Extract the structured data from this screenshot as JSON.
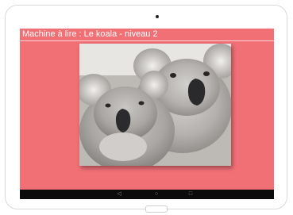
{
  "app": {
    "title": "Machine à lire : Le koala - niveau 2"
  },
  "colors": {
    "screen_background": "#f07075",
    "nav_bar": "#0b0b0b",
    "device_frame": "#ffffff"
  },
  "photo": {
    "subject": "two koalas"
  },
  "navbar": {
    "back_icon": "back-icon",
    "home_icon": "home-icon",
    "recents_icon": "recents-icon",
    "back_glyph": "◁",
    "home_glyph": "○",
    "recents_glyph": "□"
  }
}
